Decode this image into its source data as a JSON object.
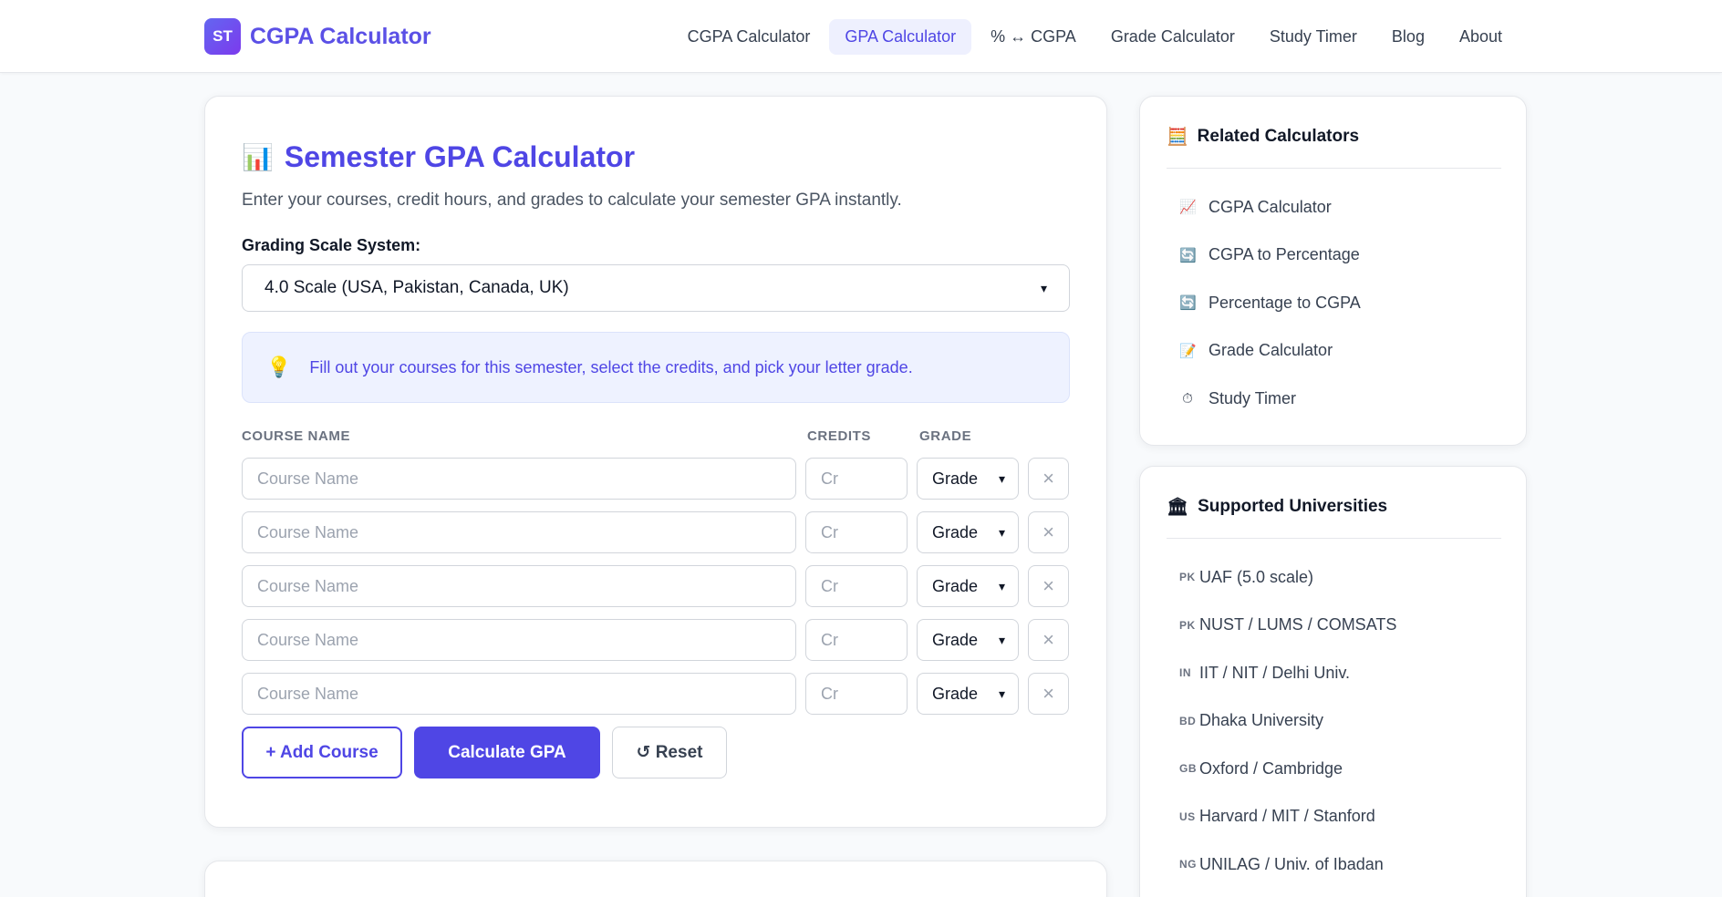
{
  "header": {
    "logo_badge": "ST",
    "logo_text": "CGPA Calculator",
    "nav": [
      {
        "label": "CGPA Calculator",
        "active": false
      },
      {
        "label": "GPA Calculator",
        "active": true
      },
      {
        "label": "% ↔ CGPA",
        "active": false
      },
      {
        "label": "Grade Calculator",
        "active": false
      },
      {
        "label": "Study Timer",
        "active": false
      },
      {
        "label": "Blog",
        "active": false
      },
      {
        "label": "About",
        "active": false
      }
    ]
  },
  "main": {
    "title_icon": "📊",
    "title": "Semester GPA Calculator",
    "subtitle": "Enter your courses, credit hours, and grades to calculate your semester GPA instantly.",
    "scale_label": "Grading Scale System:",
    "scale_value": "4.0 Scale (USA, Pakistan, Canada, UK)",
    "tip_icon": "💡",
    "tip_text": "Fill out your courses for this semester, select the credits, and pick your letter grade.",
    "columns": {
      "name": "COURSE NAME",
      "credits": "CREDITS",
      "grade": "GRADE"
    },
    "rows": [
      {
        "name_placeholder": "Course Name",
        "credits_placeholder": "Cr",
        "grade": "Grade"
      },
      {
        "name_placeholder": "Course Name",
        "credits_placeholder": "Cr",
        "grade": "Grade"
      },
      {
        "name_placeholder": "Course Name",
        "credits_placeholder": "Cr",
        "grade": "Grade"
      },
      {
        "name_placeholder": "Course Name",
        "credits_placeholder": "Cr",
        "grade": "Grade"
      },
      {
        "name_placeholder": "Course Name",
        "credits_placeholder": "Cr",
        "grade": "Grade"
      }
    ],
    "buttons": {
      "add": "+ Add Course",
      "calculate": "Calculate GPA",
      "reset": "↺ Reset"
    }
  },
  "related": {
    "icon": "🧮",
    "title": "Related Calculators",
    "items": [
      {
        "icon": "📈",
        "label": "CGPA Calculator"
      },
      {
        "icon": "🔄",
        "label": "CGPA to Percentage"
      },
      {
        "icon": "🔄",
        "label": "Percentage to CGPA"
      },
      {
        "icon": "📝",
        "label": "Grade Calculator"
      },
      {
        "icon": "⏱",
        "label": "Study Timer"
      }
    ]
  },
  "universities": {
    "icon": "🏛",
    "title": "Supported Universities",
    "items": [
      {
        "flag": "PK",
        "label": "UAF (5.0 scale)"
      },
      {
        "flag": "PK",
        "label": "NUST / LUMS / COMSATS"
      },
      {
        "flag": "IN",
        "label": "IIT / NIT / Delhi Univ."
      },
      {
        "flag": "BD",
        "label": "Dhaka University"
      },
      {
        "flag": "GB",
        "label": "Oxford / Cambridge"
      },
      {
        "flag": "US",
        "label": "Harvard / MIT / Stanford"
      },
      {
        "flag": "NG",
        "label": "UNILAG / Univ. of Ibadan"
      }
    ]
  }
}
